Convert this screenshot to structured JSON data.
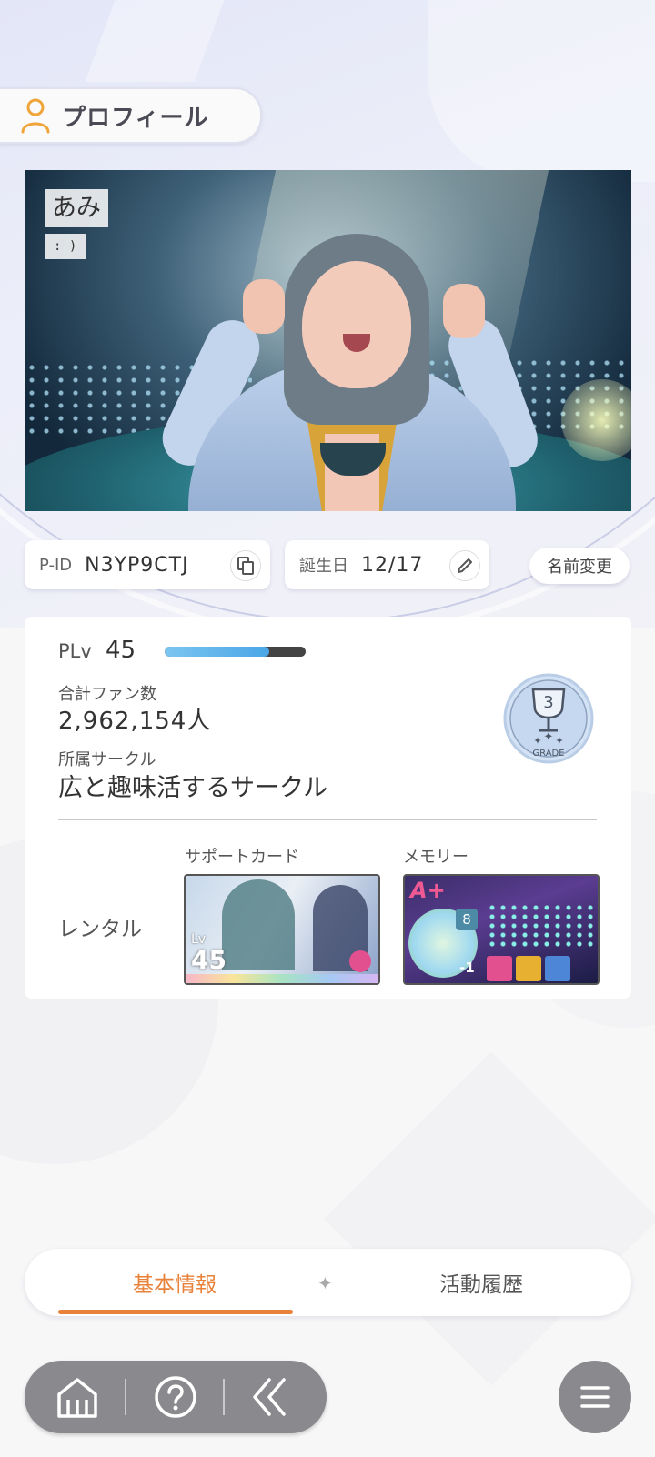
{
  "header": {
    "title": "プロフィール",
    "icon": "person-icon"
  },
  "photo": {
    "name": "あみ",
    "comment": ": )"
  },
  "pid": {
    "label": "P-ID",
    "value": "N3YP9CTJ",
    "copy_icon": "copy-icon"
  },
  "birthday": {
    "label": "誕生日",
    "value": "12/17",
    "edit_icon": "pencil-icon"
  },
  "rename_button": "名前変更",
  "stats": {
    "plv_label": "PLv",
    "plv_value": "45",
    "exp_fraction": 0.74,
    "fans_label": "合計ファン数",
    "fans_value": "2,962,154人",
    "circle_label": "所属サークル",
    "circle_value": "広と趣味活するサークル",
    "grade_number": "3",
    "grade_text": "GRADE"
  },
  "rental": {
    "label": "レンタル",
    "support_label": "サポートカード",
    "memory_label": "メモリー",
    "support_card": {
      "lv_label": "Lv",
      "level": "45"
    },
    "memory_card": {
      "rank": "A+",
      "count": "8",
      "modifier": "-1"
    }
  },
  "tabs": [
    {
      "label": "基本情報",
      "active": true
    },
    {
      "label": "活動履歴",
      "active": false
    }
  ],
  "tab_separator": "✦",
  "nav": {
    "home_icon": "home-icon",
    "help_icon": "help-icon",
    "back_icon": "back-icon",
    "menu_icon": "menu-icon"
  },
  "colors": {
    "accent": "#e8823a",
    "exp_bar": "#4aa6e6",
    "nav_bg": "#8a8a8e"
  }
}
